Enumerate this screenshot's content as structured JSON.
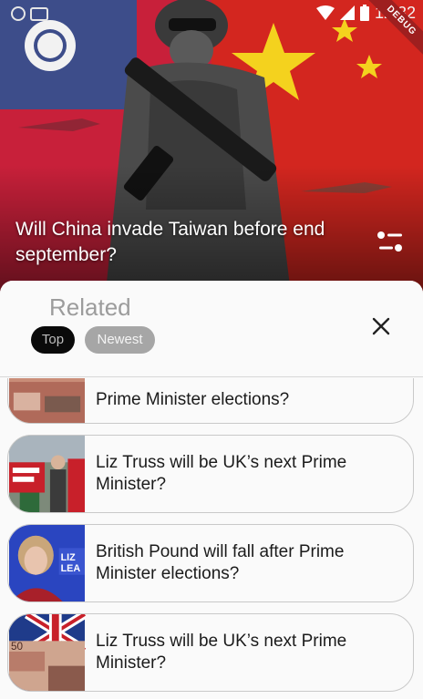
{
  "status_bar": {
    "time": "12:32",
    "debug_label": "DEBUG"
  },
  "hero": {
    "title": "Will China invade Taiwan before end september?",
    "image_icon": "soldier-flags-image"
  },
  "sheet": {
    "title": "Related",
    "chips": {
      "top": "Top",
      "newest": "Newest"
    },
    "active_chip": "Top"
  },
  "related": [
    {
      "title": "Prime Minister elections?",
      "thumb": "pound-notes-image"
    },
    {
      "title": "Liz Truss will be UK’s next Prime Minister?",
      "thumb": "protest-crowd-image"
    },
    {
      "title": "British Pound will fall after Prime Minister elections?",
      "thumb": "liz-truss-portrait-image"
    },
    {
      "title": "Liz Truss will be UK’s next Prime Minister?",
      "thumb": "pound-union-jack-image"
    }
  ],
  "colors": {
    "accent_dark": "#0a0a0a",
    "chip_inactive": "#a6a6a6",
    "sheet_bg": "#fafafa"
  }
}
